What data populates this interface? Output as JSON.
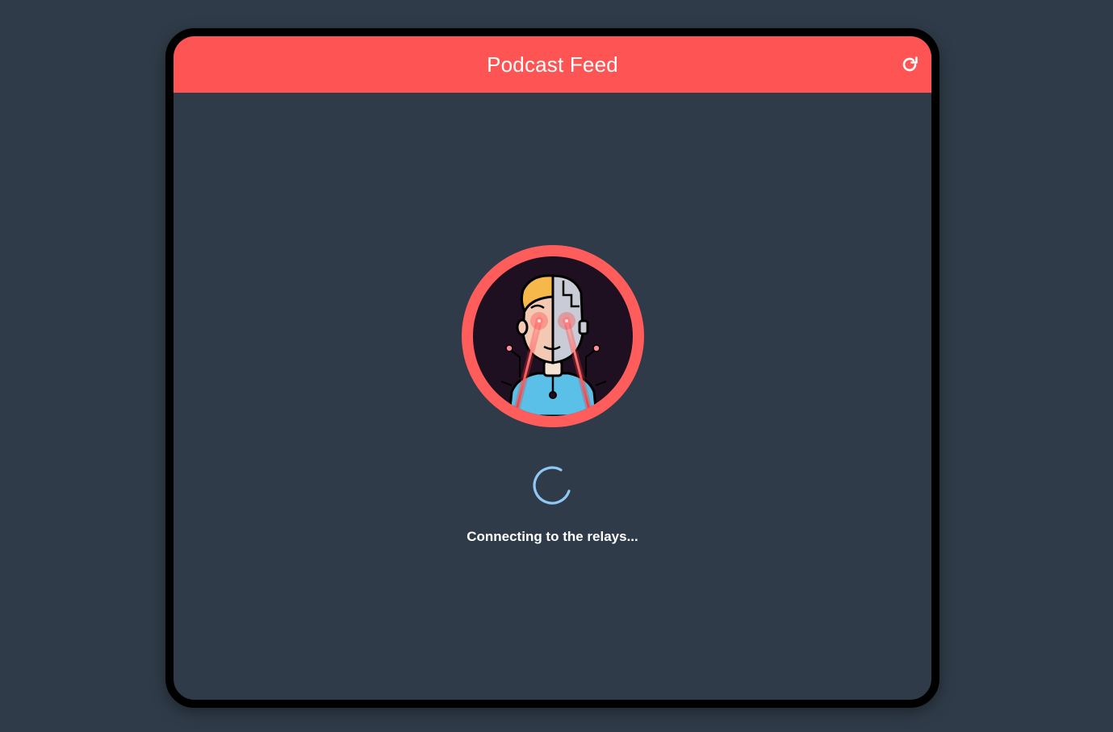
{
  "header": {
    "title": "Podcast Feed",
    "refresh_icon": "refresh-icon"
  },
  "avatar": {
    "icon": "cyborg-avatar-icon"
  },
  "loading": {
    "spinner_icon": "loading-spinner-icon",
    "status": "Connecting to the relays..."
  },
  "colors": {
    "background": "#2f3b48",
    "header": "#ff5454",
    "avatar_ring": "#ff5c5c",
    "spinner": "#8fc8f5"
  }
}
